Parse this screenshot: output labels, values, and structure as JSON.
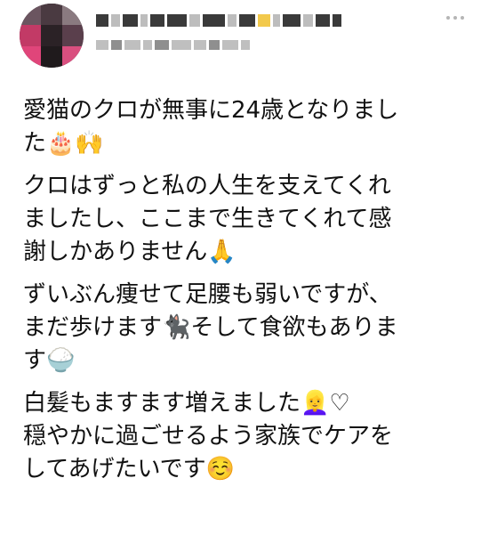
{
  "post": {
    "more_label": "•••",
    "paragraphs": [
      [
        "愛猫のクロが無事に24歳となりまし",
        "た🎂🙌"
      ],
      [
        "クロはずっと私の人生を支えてくれ",
        "ましたし、ここまで生きてくれて感",
        "謝しかありません🙏"
      ],
      [
        "ずいぶん痩せて足腰も弱いですが、",
        "まだ歩けます🐈‍⬛そして食欲もありま",
        "す🍚"
      ],
      [
        "白髪もますます増えました👱‍♀️♡",
        "穏やかに過ごせるよう家族でケアを",
        "してあげたいです☺️"
      ]
    ]
  }
}
